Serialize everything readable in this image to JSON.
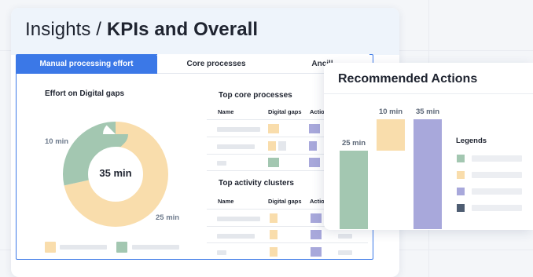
{
  "header": {
    "prefix": "Insights / ",
    "title": "KPIs and Overall"
  },
  "tabs": [
    {
      "label": "Manual processing effort",
      "active": true
    },
    {
      "label": "Core processes",
      "active": false
    },
    {
      "label": "Ancill",
      "active": false
    }
  ],
  "effort": {
    "title": "Effort on Digital gaps",
    "center_label": "35 min",
    "left_label": "10 min",
    "right_label": "25 min",
    "chart_data": {
      "type": "pie",
      "slices": [
        {
          "value": 25,
          "color": "#f9ddac"
        },
        {
          "value": 10,
          "color": "#a3c7b1"
        }
      ]
    }
  },
  "core_table": {
    "title": "Top core processes",
    "columns": [
      "Name",
      "Digital gaps",
      "Actio"
    ]
  },
  "activity_table": {
    "title": "Top activity clusters",
    "columns": [
      "Name",
      "Digital gaps",
      "Actio"
    ]
  },
  "recommended": {
    "title": "Recommended Actions",
    "legends_title": "Legends",
    "chart_data": {
      "type": "bar",
      "bars": [
        {
          "label": "25 min",
          "value": 25,
          "color": "#a3c7b1",
          "base": 0
        },
        {
          "label": "10 min",
          "value": 10,
          "color": "#f9ddac",
          "base": 25
        },
        {
          "label": "35 min",
          "value": 35,
          "color": "#a8a8db",
          "base": 0
        }
      ],
      "ylim": [
        0,
        35
      ]
    },
    "legend_colors": [
      "#a3c7b1",
      "#f9ddac",
      "#a8a8db",
      "#4e5d72"
    ]
  },
  "colors": {
    "accent": "#3b78e7",
    "green": "#a3c7b1",
    "yellow": "#f9ddac",
    "purple": "#a8a8db",
    "dark": "#4e5d72"
  }
}
